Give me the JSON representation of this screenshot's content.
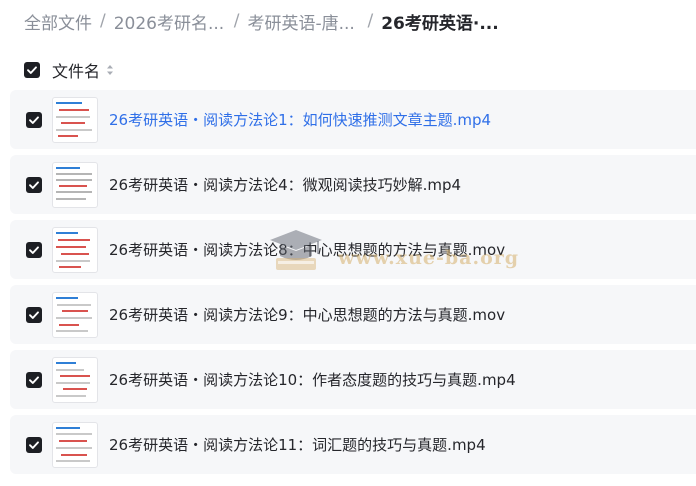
{
  "breadcrumb": {
    "items": [
      "全部文件",
      "2026考研名...",
      "考研英语-唐...",
      "26考研英语·..."
    ],
    "separator": "/"
  },
  "header": {
    "label": "文件名"
  },
  "files": [
    "26考研英语・阅读方法论1：如何快速推测文章主题.mp4",
    "26考研英语・阅读方法论4：微观阅读技巧妙解.mp4",
    "26考研英语・阅读方法论8：中心思想题的方法与真题.mov",
    "26考研英语・阅读方法论9：中心思想题的方法与真题.mov",
    "26考研英语・阅读方法论10：作者态度题的技巧与真题.mp4",
    "26考研英语・阅读方法论11：词汇题的技巧与真题.mp4"
  ],
  "watermark": "www.xue-ba.org",
  "colors": {
    "highlight_link": "#2f6fe8",
    "row_background": "#f6f7f9",
    "checkbox": "#1d1f24"
  }
}
